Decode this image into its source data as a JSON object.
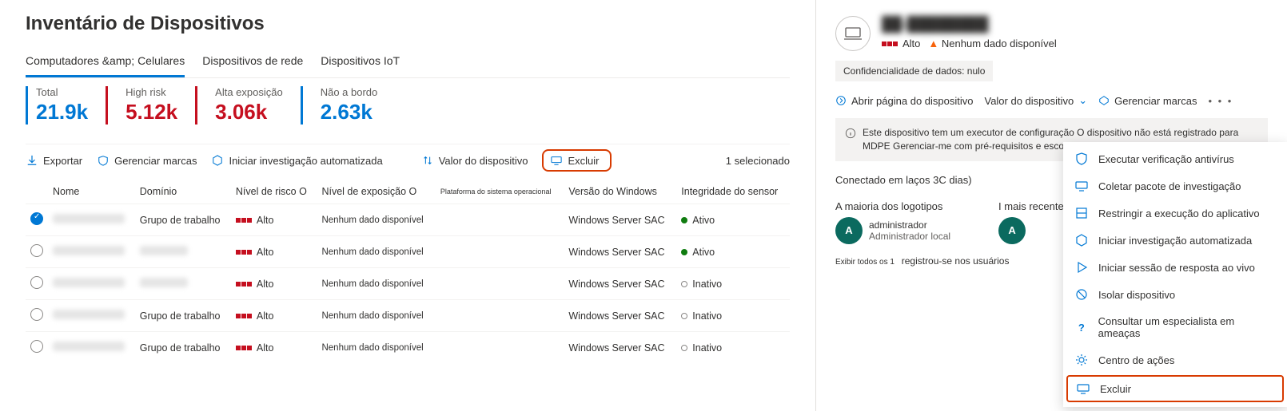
{
  "page_title": "Inventário de Dispositivos",
  "tabs": [
    {
      "label": "Computadores &amp; Celulares",
      "active": true
    },
    {
      "label": "Dispositivos de rede",
      "active": false
    },
    {
      "label": "Dispositivos IoT",
      "active": false
    }
  ],
  "stats": [
    {
      "label": "Total",
      "value": "21.9k",
      "color": "#0078d4"
    },
    {
      "label": "High risk",
      "value": "5.12k",
      "color": "#c50f1f"
    },
    {
      "label": "Alta exposição",
      "value": "3.06k",
      "color": "#c50f1f"
    },
    {
      "label": "Não a bordo",
      "value": "2.63k",
      "color": "#0078d4"
    }
  ],
  "toolbar": {
    "export": "Exportar",
    "manage_tags": "Gerenciar marcas",
    "start_investigation": "Iniciar investigação automatizada",
    "device_value": "Valor do dispositivo",
    "exclude": "Excluir",
    "selected": "1 selecionado"
  },
  "columns": {
    "name": "Nome",
    "domain": "Domínio",
    "risk": "Nível de risco O",
    "exposure": "Nível de exposição O",
    "os": "Plataforma do sistema operacional",
    "winver": "Versão do Windows",
    "sensor": "Integridade do sensor"
  },
  "rows": [
    {
      "selected": true,
      "name": "████",
      "domain": "Grupo de trabalho",
      "risk": "Alto",
      "exposure": "Nenhum dado disponível",
      "winver": "Windows Server SAC",
      "status": "Ativo",
      "status_kind": "active"
    },
    {
      "selected": false,
      "name": "████",
      "domain": "████",
      "risk": "Alto",
      "exposure": "Nenhum dado disponível",
      "winver": "Windows Server SAC",
      "status": "Ativo",
      "status_kind": "active"
    },
    {
      "selected": false,
      "name": "████",
      "domain": "████",
      "risk": "Alto",
      "exposure": "Nenhum dado disponível",
      "winver": "Windows Server SAC",
      "status": "Inativo",
      "status_kind": "inactive"
    },
    {
      "selected": false,
      "name": "████",
      "domain": "Grupo de trabalho",
      "risk": "Alto",
      "exposure": "Nenhum dado disponível",
      "winver": "Windows Server SAC",
      "status": "Inativo",
      "status_kind": "inactive"
    },
    {
      "selected": false,
      "name": "████",
      "domain": "Grupo de trabalho",
      "risk": "Alto",
      "exposure": "Nenhum dado disponível",
      "winver": "Windows Server SAC",
      "status": "Inativo",
      "status_kind": "inactive"
    }
  ],
  "panel": {
    "device_name": "██-████████",
    "risk_level": "Alto",
    "exposure_note": "Nenhum dado disponível",
    "data_badge": "Confidencialidade de dados: nulo",
    "actions": {
      "open": "Abrir página do dispositivo",
      "value": "Valor do dispositivo",
      "tags": "Gerenciar marcas"
    },
    "banner": "Este dispositivo tem um executor de configuração O dispositivo não está registrado para MDPE Gerenciar-me com pré-requisitos e escopo de imposição. O",
    "connected": "Conectado em laços 3C dias)",
    "logs_majority_label": "A maioria dos logotipos",
    "logs_recent_label": "I mais recente",
    "user_name": "administrador",
    "user_role": "Administrador local",
    "avatar_letter": "A",
    "footer_a": "Exibir todos os 1",
    "footer_b": "registrou-se nos usuários"
  },
  "menu": [
    {
      "icon": "shield",
      "label": "Executar verificação antivírus"
    },
    {
      "icon": "device",
      "label": "Coletar pacote de investigação"
    },
    {
      "icon": "restrict",
      "label": "Restringir a execução do aplicativo"
    },
    {
      "icon": "hexagon",
      "label": "Iniciar investigação automatizada"
    },
    {
      "icon": "play",
      "label": "Iniciar sessão de resposta ao vivo"
    },
    {
      "icon": "block",
      "label": "Isolar dispositivo"
    },
    {
      "icon": "question",
      "label": "Consultar um especialista em ameaças"
    },
    {
      "icon": "gear",
      "label": "Centro de ações"
    },
    {
      "icon": "device",
      "label": "Excluir",
      "highlight": true
    }
  ]
}
